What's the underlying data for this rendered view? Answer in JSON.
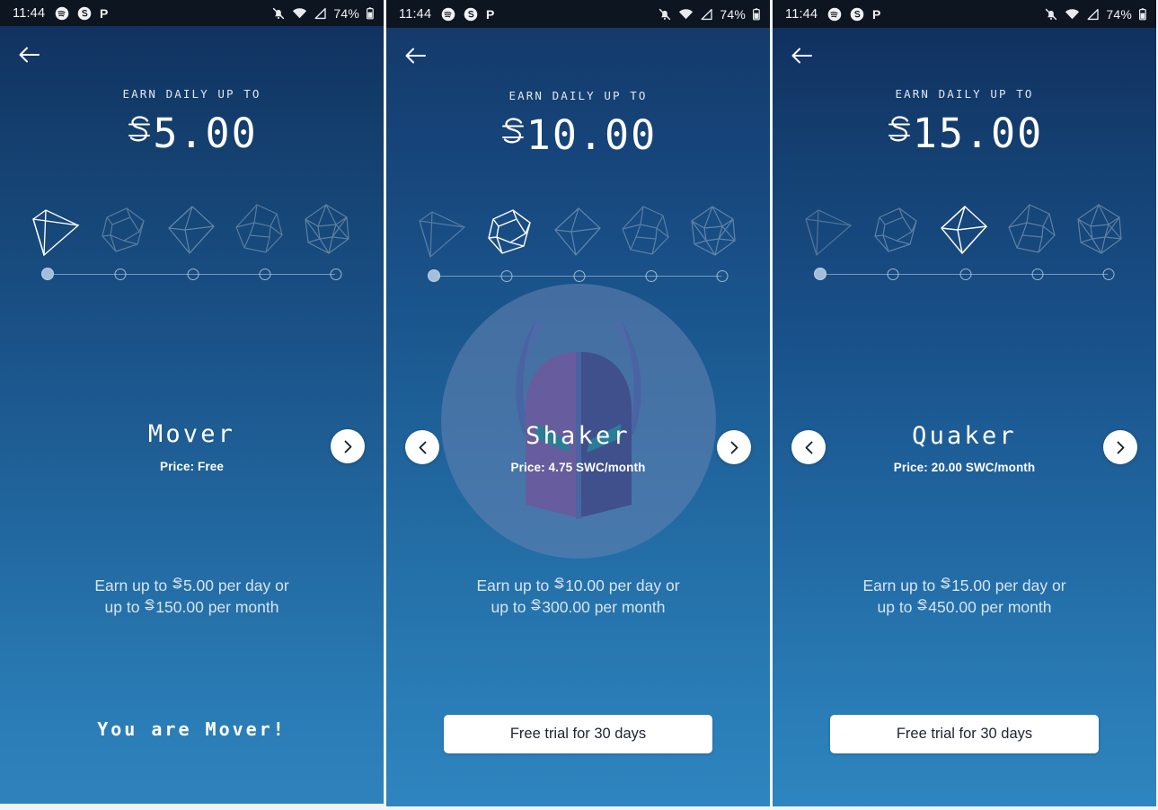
{
  "currency_symbol": "S",
  "status_bar": {
    "time": "11:44",
    "battery_text": "74%",
    "left_icons": [
      "spotify-icon",
      "swc-icon",
      "pocket-icon"
    ],
    "right_icons": [
      "notifications-off-icon",
      "wifi-icon",
      "cell-signal-icon",
      "battery-icon"
    ]
  },
  "screens": [
    {
      "id": "mover",
      "back_label": "Back",
      "earn_label": "EARN DAILY UP TO",
      "earn_amount": "5.00",
      "active_index": 0,
      "plan_name": "Mover",
      "plan_price": "Price: Free",
      "detail_line_1_pre": "Earn up to ",
      "detail_line_1_amount": "5.00",
      "detail_line_1_post": " per day or",
      "detail_line_2_pre": "up to ",
      "detail_line_2_amount": "150.00",
      "detail_line_2_post": " per month",
      "footer_text": "You are Mover!",
      "has_prev": false,
      "has_next": true,
      "has_cta": false,
      "cta_label": "",
      "has_mask": false
    },
    {
      "id": "shaker",
      "back_label": "Back",
      "earn_label": "EARN DAILY UP TO",
      "earn_amount": "10.00",
      "active_index": 1,
      "plan_name": "Shaker",
      "plan_price": "Price: 4.75 SWC/month",
      "detail_line_1_pre": "Earn up to ",
      "detail_line_1_amount": "10.00",
      "detail_line_1_post": " per day or",
      "detail_line_2_pre": "up to ",
      "detail_line_2_amount": "300.00",
      "detail_line_2_post": " per month",
      "footer_text": "",
      "has_prev": true,
      "has_next": true,
      "has_cta": true,
      "cta_label": "Free trial for 30 days",
      "has_mask": true
    },
    {
      "id": "quaker",
      "back_label": "Back",
      "earn_label": "EARN DAILY UP TO",
      "earn_amount": "15.00",
      "active_index": 2,
      "plan_name": "Quaker",
      "plan_price": "Price: 20.00 SWC/month",
      "detail_line_1_pre": "Earn up to ",
      "detail_line_1_amount": "15.00",
      "detail_line_1_post": " per day or",
      "detail_line_2_pre": "up to ",
      "detail_line_2_amount": "450.00",
      "detail_line_2_post": " per month",
      "footer_text": "",
      "has_prev": true,
      "has_next": true,
      "has_cta": true,
      "cta_label": "Free trial for 30 days",
      "has_mask": false
    }
  ],
  "tier_shapes": [
    "tetrahedron-icon",
    "cube-icon",
    "octahedron-icon",
    "dodecahedron-icon",
    "icosahedron-icon"
  ],
  "colors": {
    "bg_top": "#102f5e",
    "bg_bottom": "#2f85bf",
    "statusbar": "#0d1521",
    "accent_white": "#ffffff",
    "mask_circle": "#5f7fb0",
    "mask_helmet_left": "#6a5c9e",
    "mask_helmet_right": "#3f4f8c",
    "mask_horn": "#4f6bab",
    "mask_eye": "#2a7f96",
    "detail_text": "#d6e4f0"
  }
}
